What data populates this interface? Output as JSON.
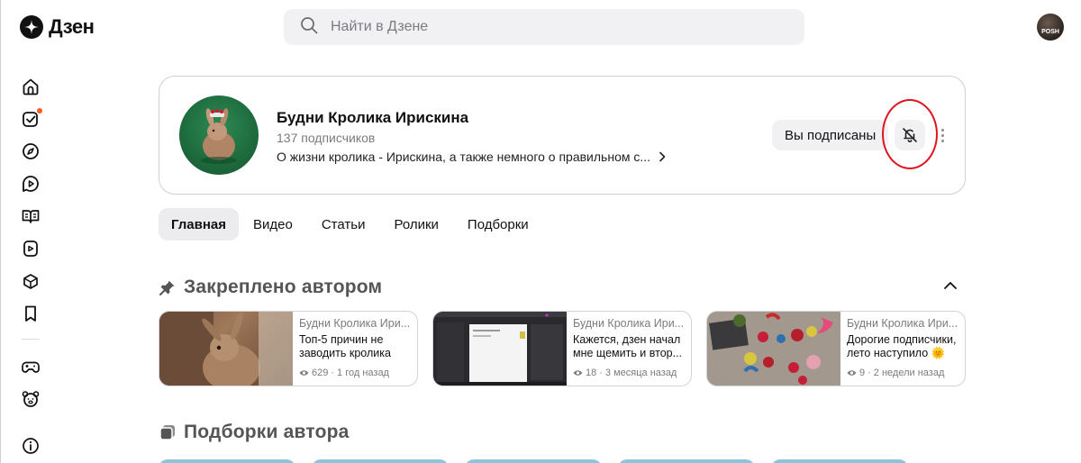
{
  "app": {
    "logo_text": "Дзен"
  },
  "search": {
    "placeholder": "Найти в Дзене"
  },
  "user": {
    "avatar_label": "POSH"
  },
  "sidebar": {
    "items": [
      {
        "icon": "home-icon"
      },
      {
        "icon": "subscriptions-icon",
        "has_notification_dot": true
      },
      {
        "icon": "compass-icon"
      },
      {
        "icon": "video-play-icon"
      },
      {
        "icon": "book-icon"
      },
      {
        "icon": "shorts-icon"
      },
      {
        "icon": "box-icon"
      },
      {
        "icon": "bookmark-icon"
      },
      {
        "icon": "gamepad-icon"
      },
      {
        "icon": "bear-icon"
      },
      {
        "icon": "info-icon"
      }
    ]
  },
  "channel": {
    "title": "Будни Кролика Ирискина",
    "subscribers": "137 подписчиков",
    "description": "О жизни кролика - Ирискина, а также немного о правильном с...",
    "subscribed_label": "Вы подписаны",
    "bell_icon": "bell-off-icon"
  },
  "tabs": [
    {
      "label": "Главная",
      "active": true
    },
    {
      "label": "Видео",
      "active": false
    },
    {
      "label": "Статьи",
      "active": false
    },
    {
      "label": "Ролики",
      "active": false
    },
    {
      "label": "Подборки",
      "active": false
    }
  ],
  "pinned": {
    "title": "Закреплено автором",
    "items": [
      {
        "channel": "Будни Кролика Ири...",
        "title": "Топ-5 причин не заводить кролика",
        "views": "629",
        "age": "1 год назад"
      },
      {
        "channel": "Будни Кролика Ири...",
        "title": "Кажется, дзен начал мне щемить и втор...",
        "views": "18",
        "age": "3 месяца назад"
      },
      {
        "channel": "Будни Кролика Ири...",
        "title": "Дорогие подписчики, лето наступило 🌞",
        "views": "9",
        "age": "2 недели назад"
      }
    ]
  },
  "collections": {
    "title": "Подборки автора"
  },
  "colors": {
    "accent_red": "#e0141e",
    "notification_dot": "#ff5a1f",
    "chip_bg": "#f1f1f3"
  }
}
